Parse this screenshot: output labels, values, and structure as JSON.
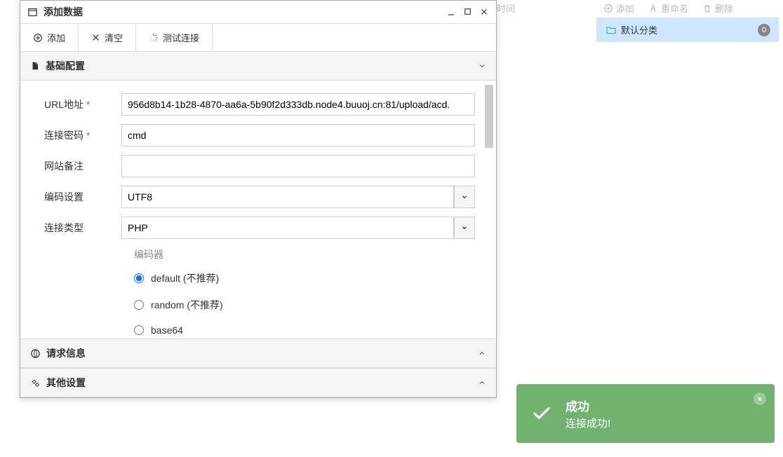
{
  "dialog": {
    "title": "添加数据",
    "toolbar": {
      "add": "添加",
      "clear": "清空",
      "test": "测试连接"
    },
    "sections": {
      "basic": "基础配置",
      "request": "请求信息",
      "other": "其他设置"
    },
    "form": {
      "url_label": "URL地址",
      "url_value": "956d8b14-1b28-4870-aa6a-5b90f2d333db.node4.buuoj.cn:81/upload/acd.",
      "pwd_label": "连接密码",
      "pwd_value": "cmd",
      "remark_label": "网站备注",
      "remark_value": "",
      "encode_label": "编码设置",
      "encode_value": "UTF8",
      "type_label": "连接类型",
      "type_value": "PHP"
    },
    "encoder": {
      "title": "编码器",
      "options": {
        "default": "default (不推荐)",
        "random": "random (不推荐)",
        "base64": "base64"
      },
      "selected": "default"
    }
  },
  "bg": {
    "time": "时间",
    "add": "添加",
    "rename": "重命名",
    "delete": "删除"
  },
  "sidebar": {
    "default_category": "默认分类",
    "count": "0"
  },
  "toast": {
    "title": "成功",
    "message": "连接成功!"
  }
}
